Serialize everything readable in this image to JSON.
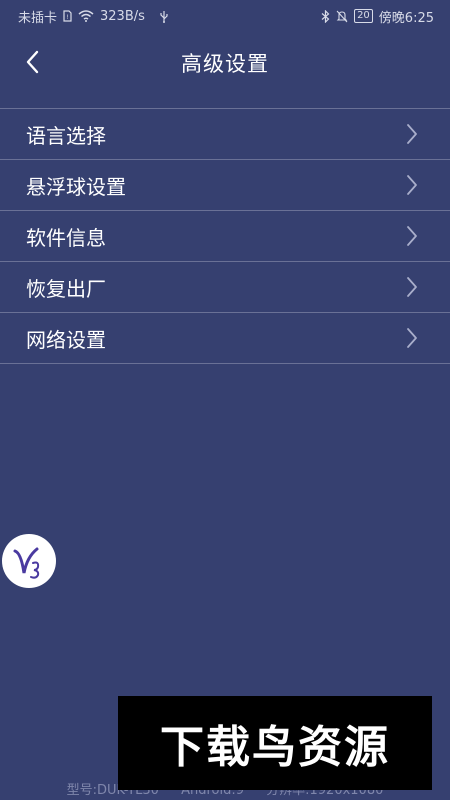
{
  "status_bar": {
    "carrier": "未插卡",
    "speed": "323B/s",
    "battery": "20",
    "time": "傍晚6:25",
    "icons": [
      "sim-icon",
      "wifi-icon",
      "usb-icon",
      "bluetooth-icon",
      "mute-icon",
      "battery-icon"
    ]
  },
  "header": {
    "title": "高级设置",
    "back_icon": "chevron-left-icon"
  },
  "menu": {
    "items": [
      {
        "label": "语言选择"
      },
      {
        "label": "悬浮球设置"
      },
      {
        "label": "软件信息"
      },
      {
        "label": "恢复出厂"
      },
      {
        "label": "网络设置"
      }
    ],
    "chevron_icon": "chevron-right-icon"
  },
  "floating_ball": {
    "icon": "v3-logo-icon",
    "letter": "V",
    "number": "3"
  },
  "footer": {
    "model": "型号:DUK-TL30",
    "android": "Android:9",
    "resolution": "分辨率:1920x1080"
  },
  "watermark": {
    "text": "下载鸟资源"
  },
  "colors": {
    "background": "#364070",
    "divider": "#6a7196",
    "text": "#ffffff",
    "footer_text": "#7f86ab",
    "logo": "#4a3aa0"
  }
}
